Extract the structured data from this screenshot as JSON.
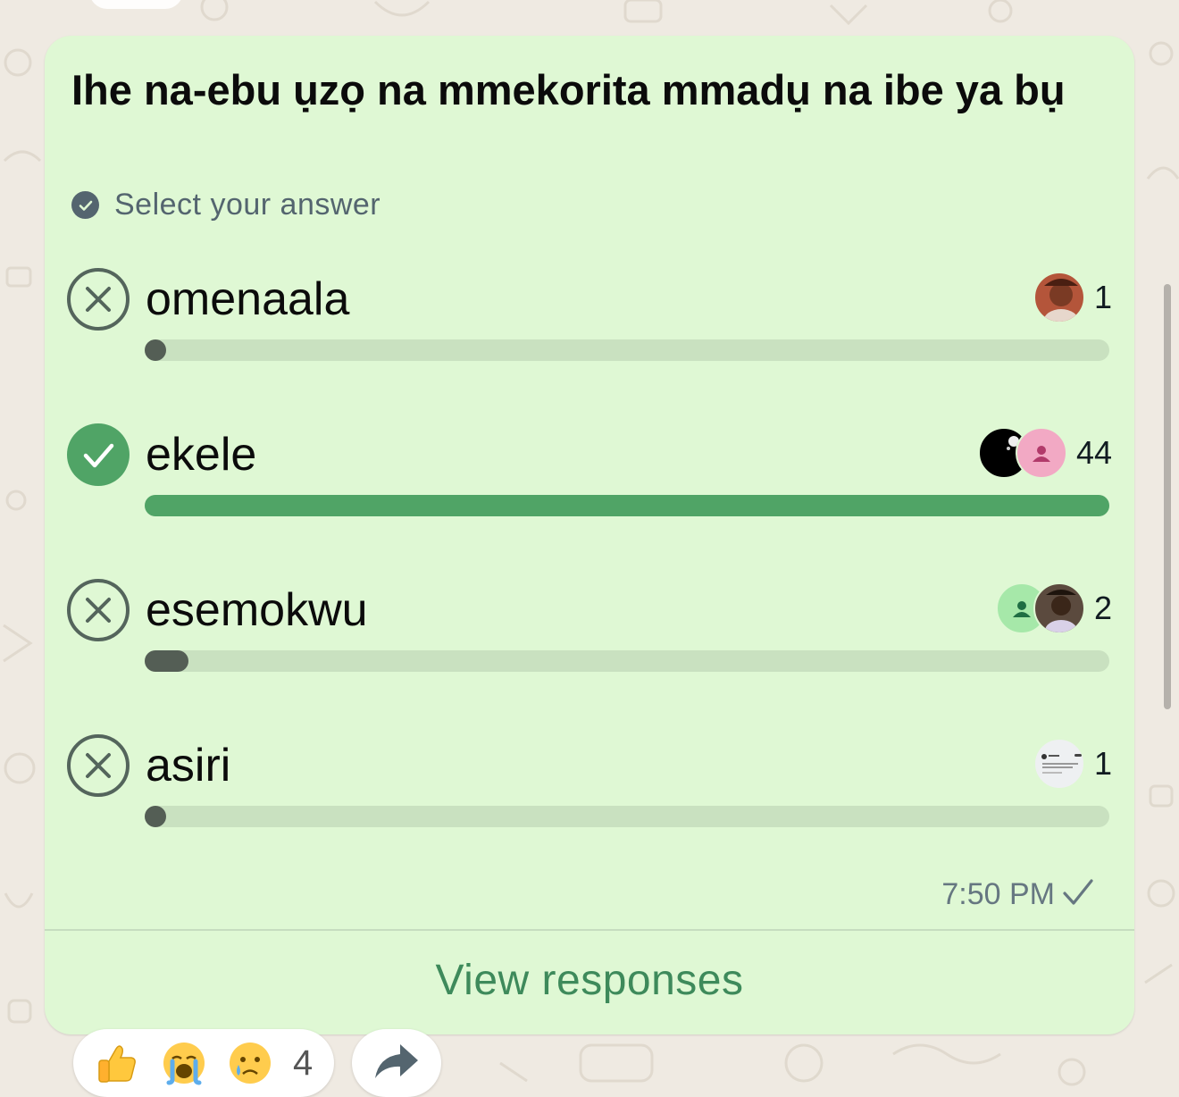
{
  "poll": {
    "question": "Ihe na-ebu ụzọ na mmekorita mmadụ na ibe ya bụ",
    "hint": "Select your answer",
    "options": [
      {
        "label": "omenaala",
        "votes": "1",
        "correct": false,
        "share": 0.02
      },
      {
        "label": "ekele",
        "votes": "44",
        "correct": true,
        "share": 1.0
      },
      {
        "label": "esemokwu",
        "votes": "2",
        "correct": false,
        "share": 0.045
      },
      {
        "label": "asiri",
        "votes": "1",
        "correct": false,
        "share": 0.02
      }
    ],
    "time": "7:50 PM",
    "view_responses": "View responses"
  },
  "reactions": {
    "emojis": [
      "thumbs-up-emoji",
      "loudly-crying-emoji",
      "crying-emoji"
    ],
    "count": "4"
  },
  "colors": {
    "bubble": "#dff8d4",
    "accent_green": "#50a466",
    "link_green": "#3e8a5b",
    "bar_dark": "#545e55",
    "track": "#c9e1c0"
  }
}
